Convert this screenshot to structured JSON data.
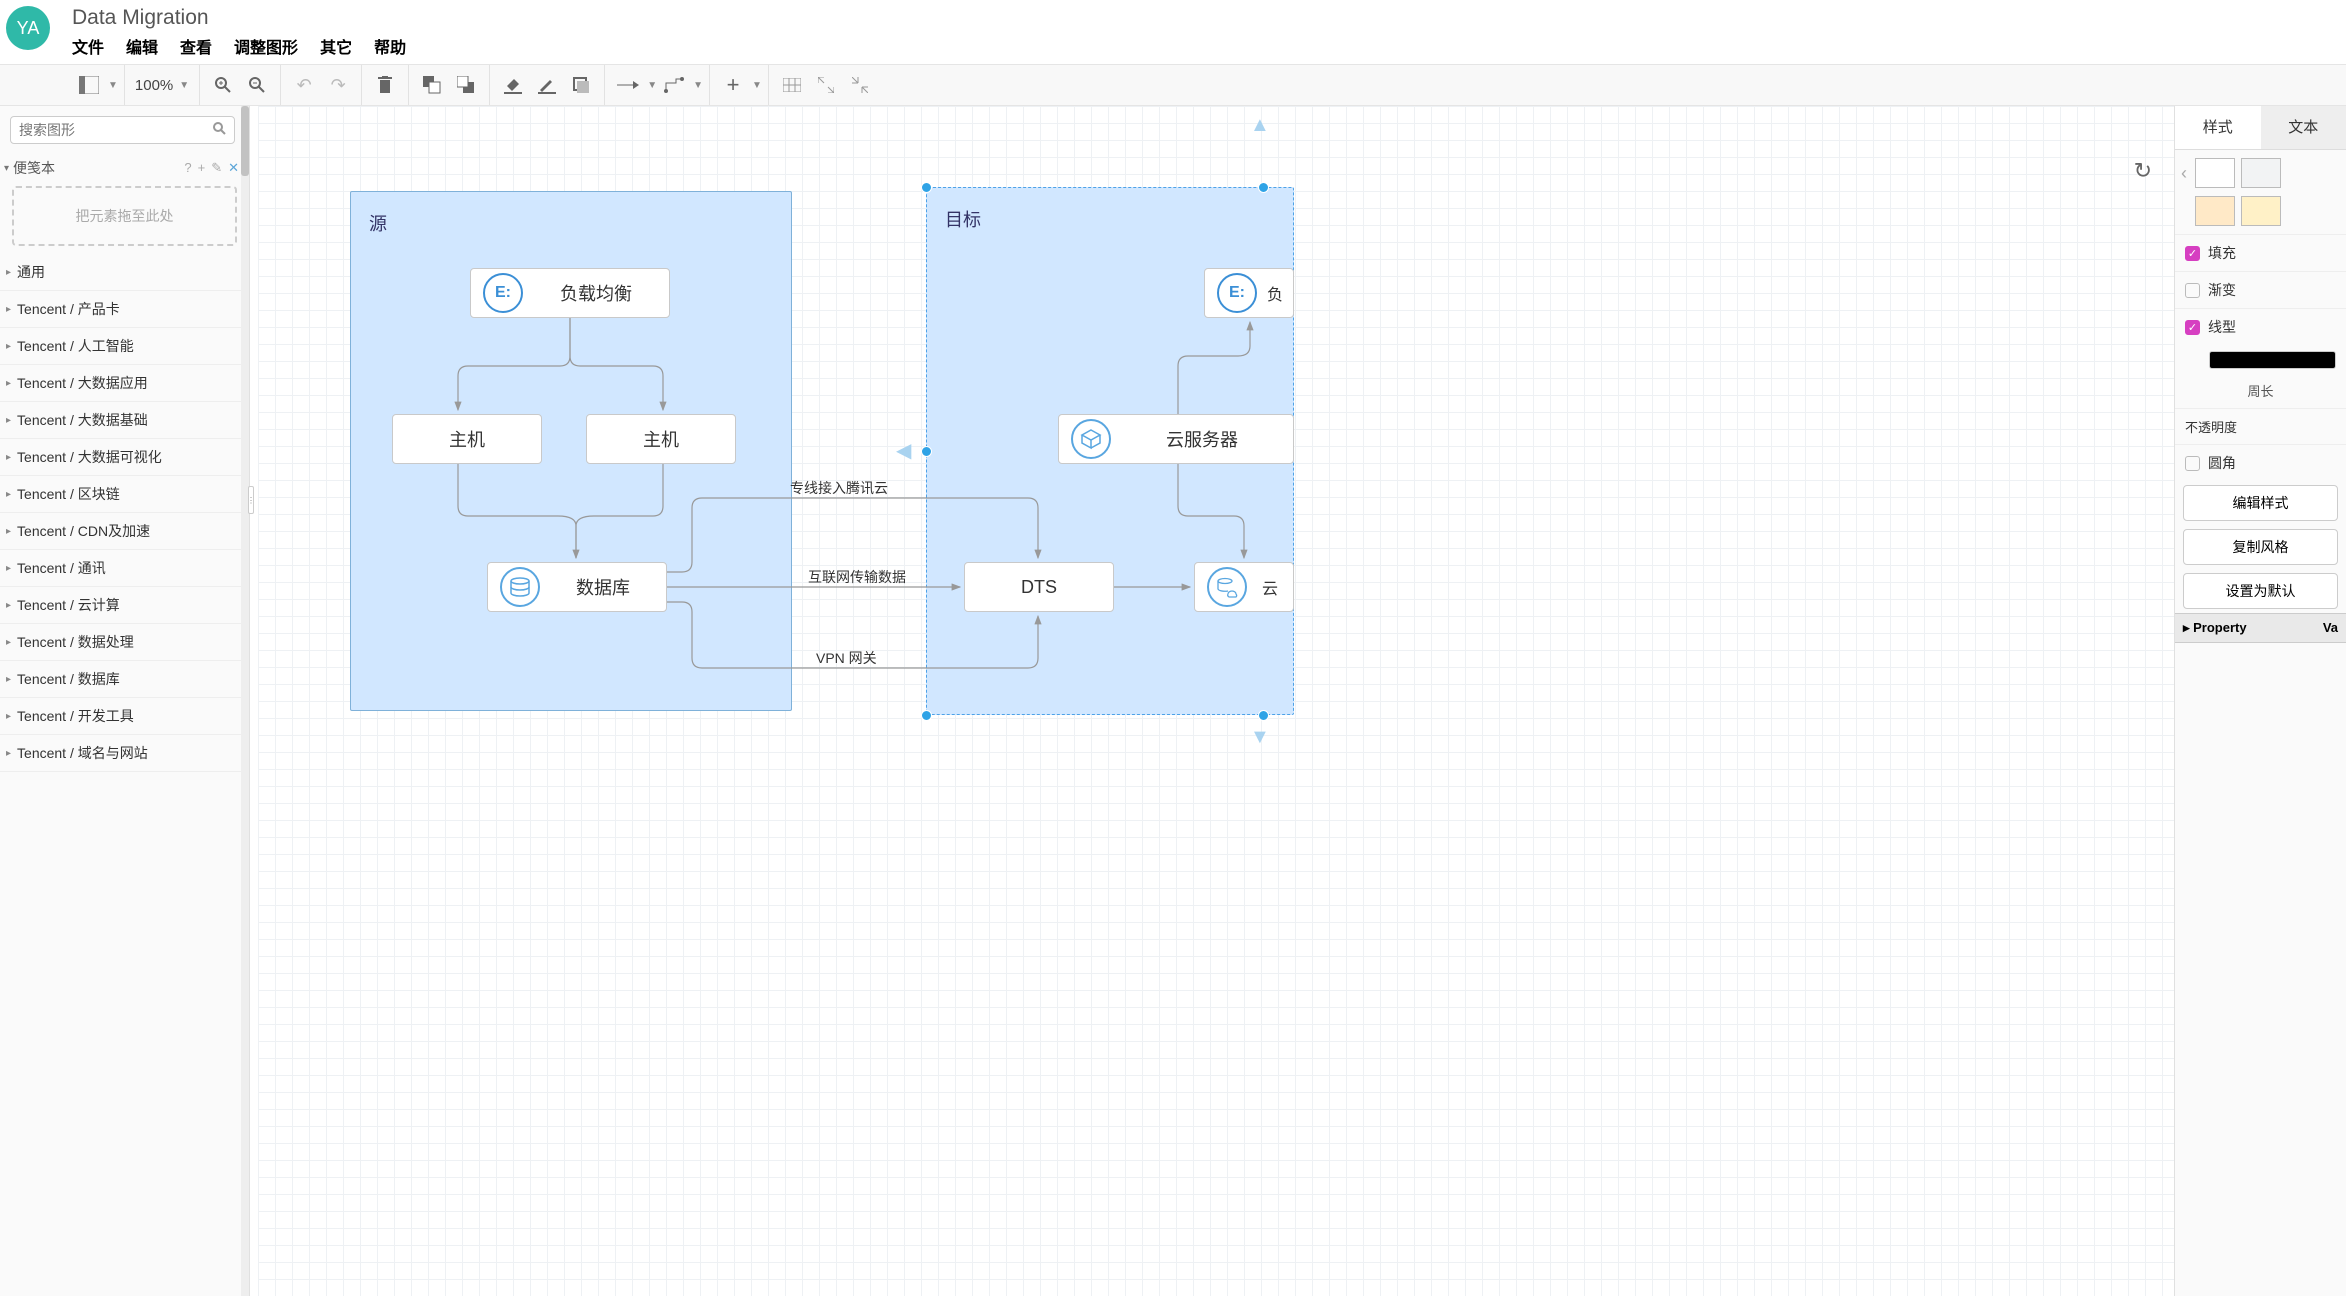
{
  "app": {
    "avatar": "YA",
    "title": "Data Migration"
  },
  "menus": [
    "文件",
    "编辑",
    "查看",
    "调整图形",
    "其它",
    "帮助"
  ],
  "toolbar": {
    "zoom": "100%"
  },
  "left": {
    "search_placeholder": "搜索图形",
    "scratchpad_title": "便笺本",
    "dropzone": "把元素拖至此处",
    "categories": [
      "通用",
      "Tencent / 产品卡",
      "Tencent / 人工智能",
      "Tencent / 大数据应用",
      "Tencent / 大数据基础",
      "Tencent / 大数据可视化",
      "Tencent / 区块链",
      "Tencent / CDN及加速",
      "Tencent / 通讯",
      "Tencent / 云计算",
      "Tencent / 数据处理",
      "Tencent / 数据库",
      "Tencent / 开发工具",
      "Tencent / 域名与网站"
    ]
  },
  "diagram": {
    "groups": {
      "source": {
        "title": "源"
      },
      "target": {
        "title": "目标"
      }
    },
    "nodes": {
      "lb": {
        "label": "负载均衡",
        "icon": "E:"
      },
      "host1": {
        "label": "主机"
      },
      "host2": {
        "label": "主机"
      },
      "db": {
        "label": "数据库"
      },
      "dts": {
        "label": "DTS"
      },
      "lb2": {
        "label": "负",
        "icon": "E:"
      },
      "cvm": {
        "label": "云服务器"
      },
      "cdb": {
        "label": "云"
      }
    },
    "edges": {
      "direct": "专线接入腾讯云",
      "internet": "互联网传输数据",
      "vpn": "VPN 网关"
    }
  },
  "right": {
    "tabs": {
      "style": "样式",
      "text": "文本"
    },
    "swatches_row1": [
      "#ffffff",
      "#f2f2f2"
    ],
    "swatches_row2": [
      "#ffe9c7",
      "#fff1c7"
    ],
    "fill": "填充",
    "gradient": "渐变",
    "stroke": "线型",
    "perimeter": "周长",
    "opacity": "不透明度",
    "rounded": "圆角",
    "editstyle": "编辑样式",
    "copystyle": "复制风格",
    "setdefault": "设置为默认",
    "property": "Property",
    "value": "Va"
  }
}
